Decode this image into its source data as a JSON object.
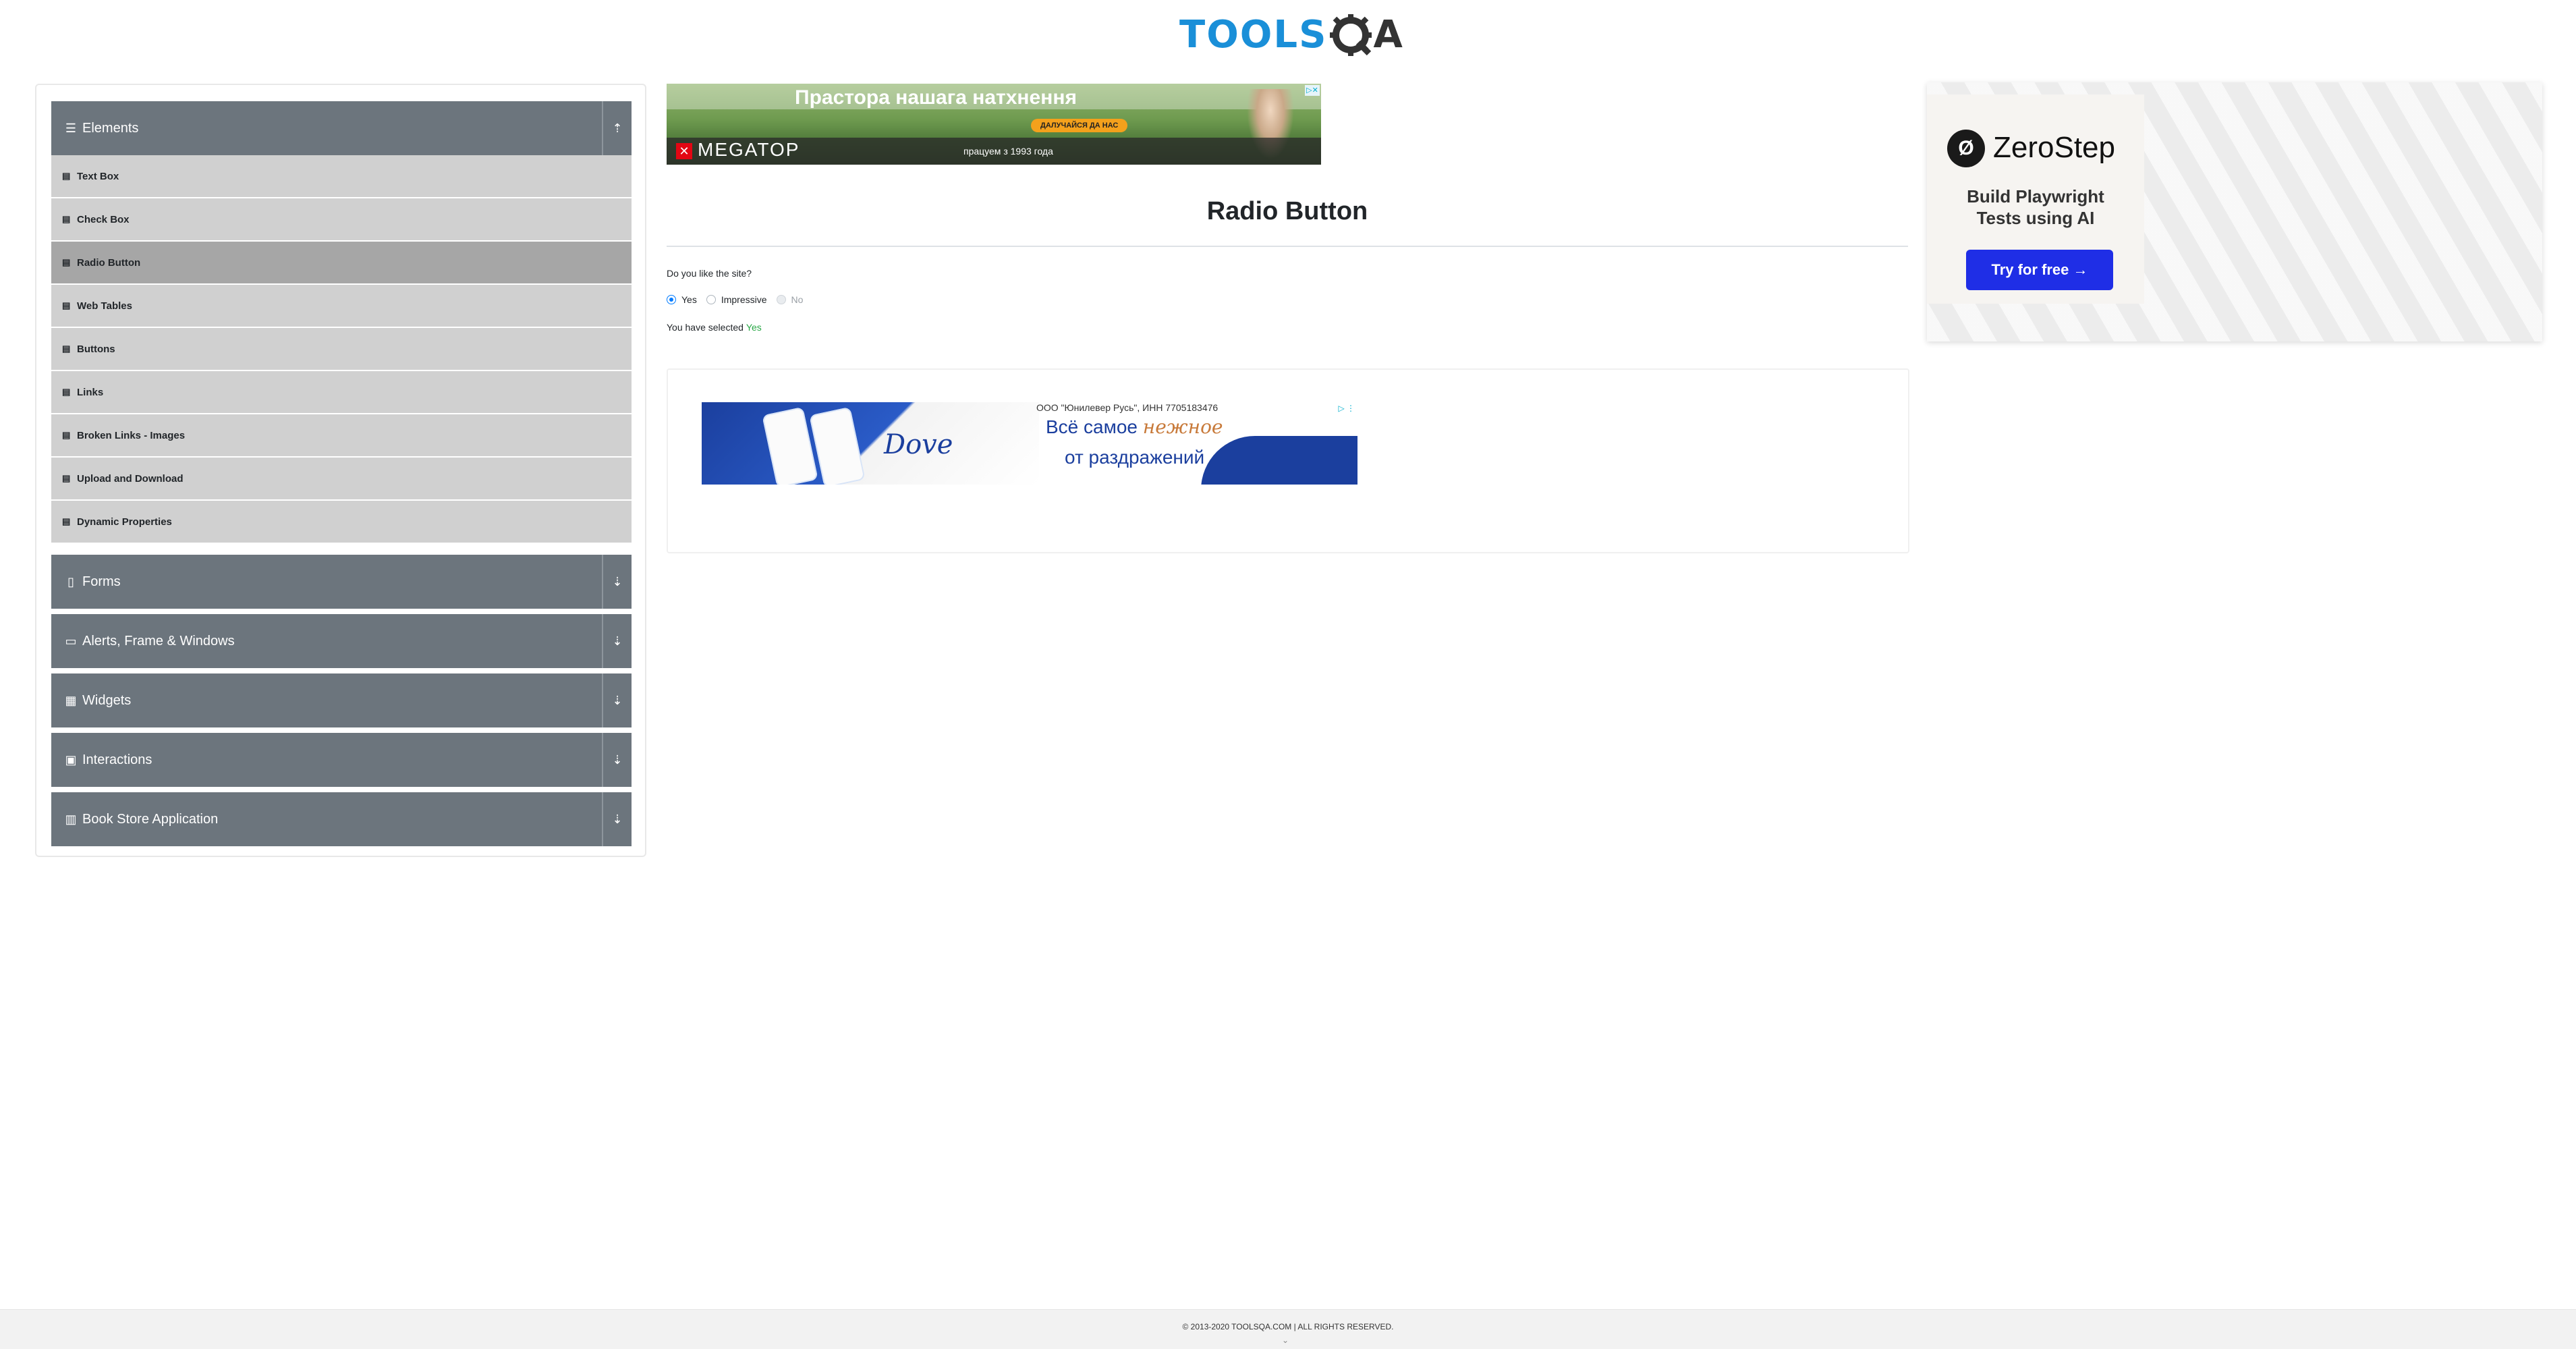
{
  "logo": {
    "text_left": "TOOLS",
    "text_right": "A"
  },
  "sidebar": {
    "groups": [
      {
        "label": "Elements",
        "icon": "hamburger-icon",
        "expanded": true
      },
      {
        "label": "Forms",
        "icon": "document-icon",
        "expanded": false
      },
      {
        "label": "Alerts, Frame & Windows",
        "icon": "window-icon",
        "expanded": false
      },
      {
        "label": "Widgets",
        "icon": "grid-icon",
        "expanded": false
      },
      {
        "label": "Interactions",
        "icon": "box-icon",
        "expanded": false
      },
      {
        "label": "Book Store Application",
        "icon": "book-icon",
        "expanded": false
      }
    ],
    "items": [
      {
        "label": "Text Box"
      },
      {
        "label": "Check Box"
      },
      {
        "label": "Radio Button"
      },
      {
        "label": "Web Tables"
      },
      {
        "label": "Buttons"
      },
      {
        "label": "Links"
      },
      {
        "label": "Broken Links - Images"
      },
      {
        "label": "Upload and Download"
      },
      {
        "label": "Dynamic Properties"
      }
    ],
    "active_item": "Radio Button"
  },
  "ad_top": {
    "headline": "Прастора нашага натхнення",
    "cta": "ДАЛУЧАЙСЯ ДА НАС",
    "brand": "MEGATOP",
    "since": "працуем з 1993 года"
  },
  "main": {
    "title": "Radio Button",
    "question": "Do you like the site?",
    "options": [
      {
        "label": "Yes",
        "checked": true,
        "disabled": false
      },
      {
        "label": "Impressive",
        "checked": false,
        "disabled": false
      },
      {
        "label": "No",
        "checked": false,
        "disabled": true
      }
    ],
    "result_prefix": "You have selected",
    "result_value": "Yes"
  },
  "ad_mid": {
    "legal": "ООО \"Юнилевер Русь\", ИНН 7705183476",
    "brand": "Dove",
    "line1_a": "Всё самое",
    "line1_b": "нежное",
    "line2": "от раздражений"
  },
  "ad_right": {
    "brand": "ZeroStep",
    "tagline_1": "Build Playwright",
    "tagline_2": "Tests using AI",
    "cta": "Try for free →"
  },
  "footer": {
    "copyright": "© 2013-2020 TOOLSQA.COM | ALL RIGHTS RESERVED."
  },
  "colors": {
    "accent": "#1a8fd8",
    "sidebar_header": "#6c757d",
    "menu_item": "#d0d0d0",
    "menu_item_active": "#a6a6a6",
    "success": "#28a745",
    "radio": "#007bff",
    "zerostep_button": "#1f2ee6"
  }
}
